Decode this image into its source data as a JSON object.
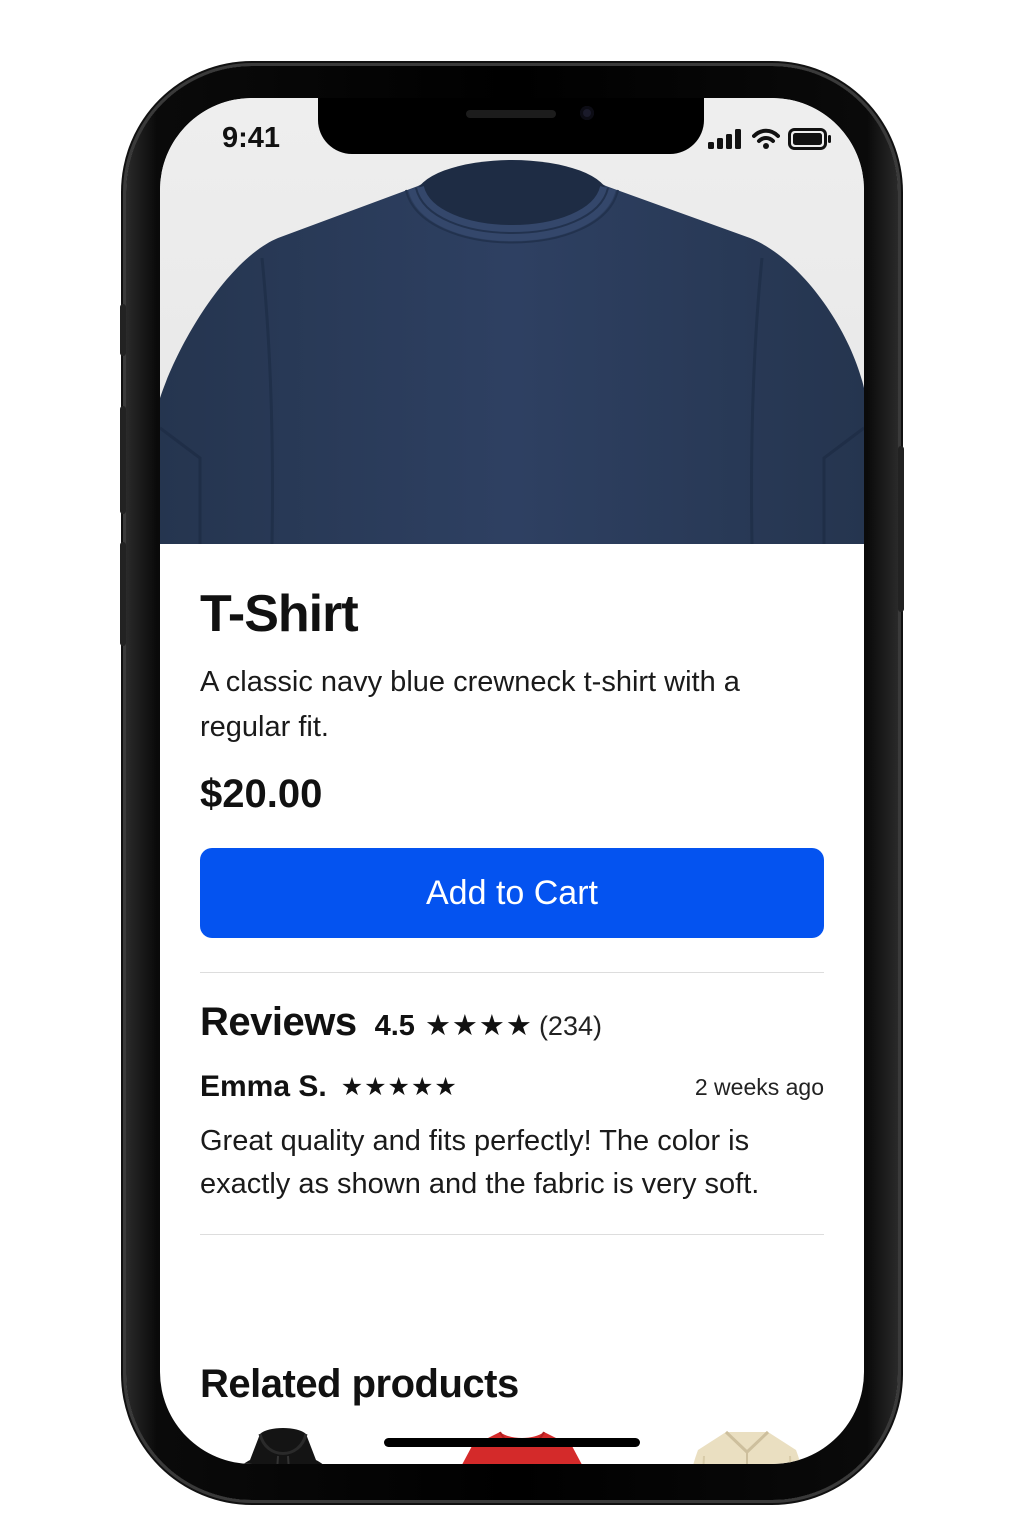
{
  "status_bar": {
    "time": "9:41",
    "icons": [
      "signal-icon",
      "wifi-icon",
      "battery-icon"
    ]
  },
  "product": {
    "image": "navy-tshirt-image",
    "title": "T-Shirt",
    "description": "A classic navy blue crewneck t-shirt with a regular fit.",
    "price": "$20.00",
    "add_to_cart_label": "Add to Cart"
  },
  "reviews": {
    "title": "Reviews",
    "average": "4.5",
    "average_stars": "★★★★",
    "count": "(234)",
    "items": [
      {
        "author": "Emma S.",
        "stars": "★★★★★",
        "date": "2 weeks ago",
        "text": "Great quality and fits perfectly! The color is exactly as shown and the fabric is very soft."
      }
    ]
  },
  "related": {
    "title": "Related products",
    "items": [
      {
        "image": "black-hoodie-image",
        "color": "#141414"
      },
      {
        "image": "red-dress-image",
        "color": "#d42a2a"
      },
      {
        "image": "beige-shirt-image",
        "color": "#eadfc1"
      }
    ]
  },
  "colors": {
    "accent": "#0453f0",
    "shirt": "#2b3d5d"
  }
}
